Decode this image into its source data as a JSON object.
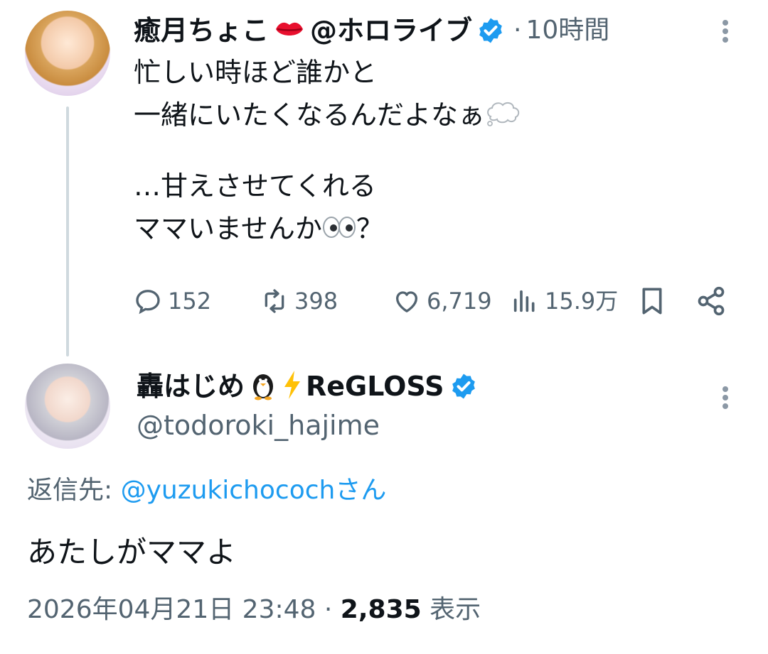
{
  "tweet1": {
    "display_name": "癒月ちょこ",
    "affiliation": "@ホロライブ",
    "separator": "·",
    "time": "10時間",
    "lines": [
      "忙しい時ほど誰かと",
      "一緒にいたくなるんだよなぁ"
    ],
    "lines2": [
      "…甘えさせてくれる",
      "ママいませんか"
    ],
    "question_mark": "？",
    "stats": {
      "replies": "152",
      "retweets": "398",
      "likes": "6,719",
      "views": "15.9万"
    }
  },
  "tweet2": {
    "display_name": "轟はじめ",
    "affiliation": "ReGLOSS",
    "handle": "@todoroki_hajime",
    "reply_prefix": "返信先: ",
    "reply_to": "@yuzukichococh",
    "reply_suffix": "さん",
    "body": "あたしがママよ",
    "timestamp": "2026年04月21日 23:48",
    "dot": "·",
    "view_count": "2,835",
    "view_label": "表示"
  },
  "colors": {
    "verified": "#1d9bf0",
    "muted": "#536471",
    "link": "#1d9bf0",
    "thread_line": "#cfd9de"
  }
}
